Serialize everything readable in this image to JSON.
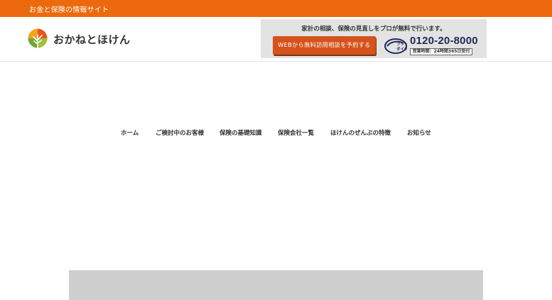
{
  "topbar": {
    "tagline": "お金と保険の情報サイト"
  },
  "brand": {
    "name": "おかねとほけん"
  },
  "cta": {
    "heading": "家計の相談、保険の見直しをプロが無料で行います。",
    "button_label": "WEBから無料訪問相談を予約する",
    "phone": "0120-20-8000",
    "hours": "営業時間：24時間365日受付"
  },
  "nav": {
    "items": [
      {
        "label": "ホーム"
      },
      {
        "label": "ご検討中のお客様"
      },
      {
        "label": "保険の基礎知識"
      },
      {
        "label": "保険会社一覧"
      },
      {
        "label": "ほけんのぜんぶの特徴"
      },
      {
        "label": "お知らせ"
      }
    ]
  },
  "colors": {
    "brand_orange": "#ec6a0d",
    "cta_button": "#d5531c",
    "phone_navy": "#1d2a5a"
  },
  "icons": {
    "logo": "tree-logo-icon",
    "freedial": "freedial-icon"
  }
}
